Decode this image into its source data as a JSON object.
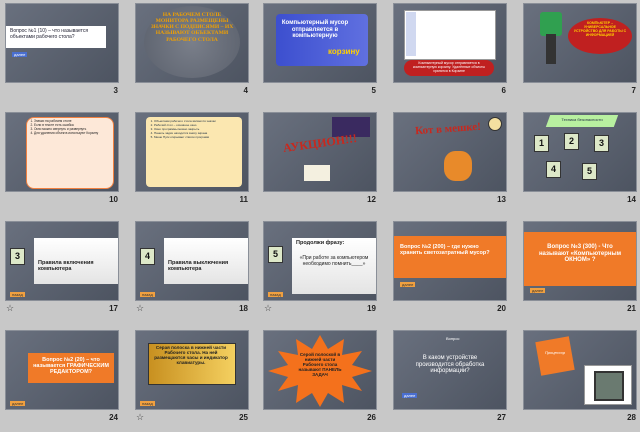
{
  "slides": [
    {
      "num": "3",
      "text": "Вопрос №1 (10) – что называется объектами рабочего стола?"
    },
    {
      "num": "4",
      "text": "НА РАБОЧЕМ СТОЛЕ МОНИТОРА РАЗМЕЩЕНЫ ЗНАЧКИ С ПОДПИСЯМИ – ИХ НАЗЫВАЮТ ОБЪЕКТАМИ РАБОЧЕГО СТОЛА"
    },
    {
      "num": "5",
      "text": "Компьютерный мусор отправляется в компьютерную",
      "word": "корзину"
    },
    {
      "num": "6",
      "text": "Компьютерный мусор отправляется в компьютерную корзину. Удалённые объекты хранятся в Корзине"
    },
    {
      "num": "7",
      "text": "КОМПЬЮТЕР – УНИВЕРСАЛЬНОЕ УСТРОЙСТВО ДЛЯ РАБОТЫ С ИНФОРМАЦИЕЙ"
    },
    {
      "num": "10",
      "items": [
        "Значки на рабочем столе",
        "Если в тексте есть ошибка",
        "Окно можно свернуть и развернуть",
        "Для удаления объекта используют Корзину"
      ]
    },
    {
      "num": "11",
      "items": [
        "Объектами рабочего стола являются значки",
        "Рабочий стол – основное окно",
        "Окно программы можно закрыть",
        "Панель задач находится внизу экрана",
        "Меню Пуск открывает список программ"
      ]
    },
    {
      "num": "12",
      "text": "АУКЦИОН!!!"
    },
    {
      "num": "13",
      "text": "Кот в мешке!"
    },
    {
      "num": "14",
      "title": "Техника безопасности",
      "tickets": [
        "1",
        "2",
        "3",
        "4",
        "5"
      ]
    },
    {
      "num": "17",
      "ticket": "3",
      "text": "Правила включения компьютера"
    },
    {
      "num": "18",
      "ticket": "4",
      "text": "Правила выключения компьютера"
    },
    {
      "num": "19",
      "ticket": "5",
      "text": "Продолжи фразу:",
      "quote": "«При работе за компьютером необходимо помнить____»"
    },
    {
      "num": "20",
      "text": "Вопрос №2 (200) – где нужно хранить светозатратный мусор?"
    },
    {
      "num": "21",
      "text": "Вопрос №3 (300) - Что называют «Компьютерным ОКНОМ» ?"
    },
    {
      "num": "24",
      "text": "Вопрос №2 (20) – что называется ГРАФИЧЕСКИМ РЕДАКТОРОМ?"
    },
    {
      "num": "25",
      "text": "Серая полоска в нижней части Рабочего стола. На ней размещаются часы и индикатор клавиатуры."
    },
    {
      "num": "26",
      "text": "Серой полоской в нижней части Рабочего стола называют ПАНЕЛЬ ЗАДАЧ"
    },
    {
      "num": "27",
      "label": "Вопрос",
      "text": "В каком устройстве производится обработка информации?"
    },
    {
      "num": "28",
      "text": "Процессор"
    }
  ],
  "buttons": {
    "next": "далее",
    "back": "назад"
  },
  "colors": {
    "slide_bg": "#5e6572",
    "orange": "#f07a28",
    "page_bg": "#c8c8c8"
  }
}
